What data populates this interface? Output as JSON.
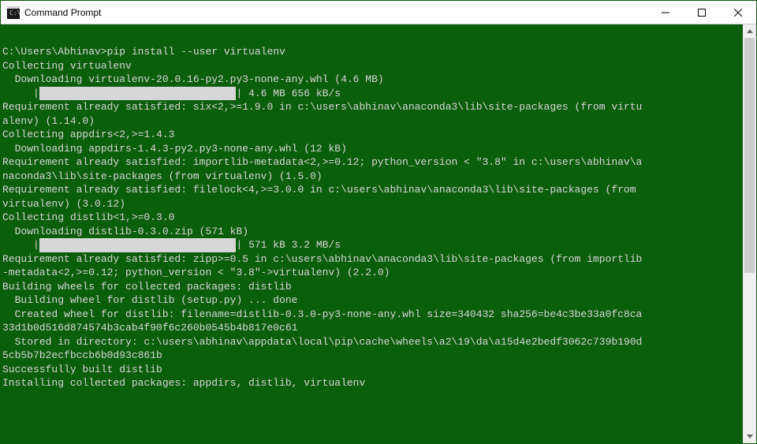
{
  "window": {
    "title": "Command Prompt"
  },
  "terminal": {
    "prompt_line": "C:\\Users\\Abhinav>pip install --user virtualenv",
    "l1": "Collecting virtualenv",
    "l2": "  Downloading virtualenv-20.0.16-py2.py3-none-any.whl (4.6 MB)",
    "p1_prefix": "     |",
    "p1_suffix": "| 4.6 MB 656 kB/s",
    "l3a": "Requirement already satisfied: six<2,>=1.9.0 in c:\\users\\abhinav\\anaconda3\\lib\\site-packages (from virtu",
    "l3b": "alenv) (1.14.0)",
    "l4": "Collecting appdirs<2,>=1.4.3",
    "l5": "  Downloading appdirs-1.4.3-py2.py3-none-any.whl (12 kB)",
    "l6a": "Requirement already satisfied: importlib-metadata<2,>=0.12; python_version < \"3.8\" in c:\\users\\abhinav\\a",
    "l6b": "naconda3\\lib\\site-packages (from virtualenv) (1.5.0)",
    "l7a": "Requirement already satisfied: filelock<4,>=3.0.0 in c:\\users\\abhinav\\anaconda3\\lib\\site-packages (from ",
    "l7b": "virtualenv) (3.0.12)",
    "l8": "Collecting distlib<1,>=0.3.0",
    "l9": "  Downloading distlib-0.3.0.zip (571 kB)",
    "p2_prefix": "     |",
    "p2_suffix": "| 571 kB 3.2 MB/s",
    "l10a": "Requirement already satisfied: zipp>=0.5 in c:\\users\\abhinav\\anaconda3\\lib\\site-packages (from importlib",
    "l10b": "-metadata<2,>=0.12; python_version < \"3.8\"->virtualenv) (2.2.0)",
    "l11": "Building wheels for collected packages: distlib",
    "l12": "  Building wheel for distlib (setup.py) ... done",
    "l13a": "  Created wheel for distlib: filename=distlib-0.3.0-py3-none-any.whl size=340432 sha256=be4c3be33a0fc8ca",
    "l13b": "33d1b0d516d874574b3cab4f90f6c260b0545b4b817e0c61",
    "l14a": "  Stored in directory: c:\\users\\abhinav\\appdata\\local\\pip\\cache\\wheels\\a2\\19\\da\\a15d4e2bedf3062c739b190d",
    "l14b": "5cb5b7b2ecfbccb6b0d93c861b",
    "l15": "Successfully built distlib",
    "l16": "Installing collected packages: appdirs, distlib, virtualenv"
  },
  "progress_bar_block": "                                "
}
